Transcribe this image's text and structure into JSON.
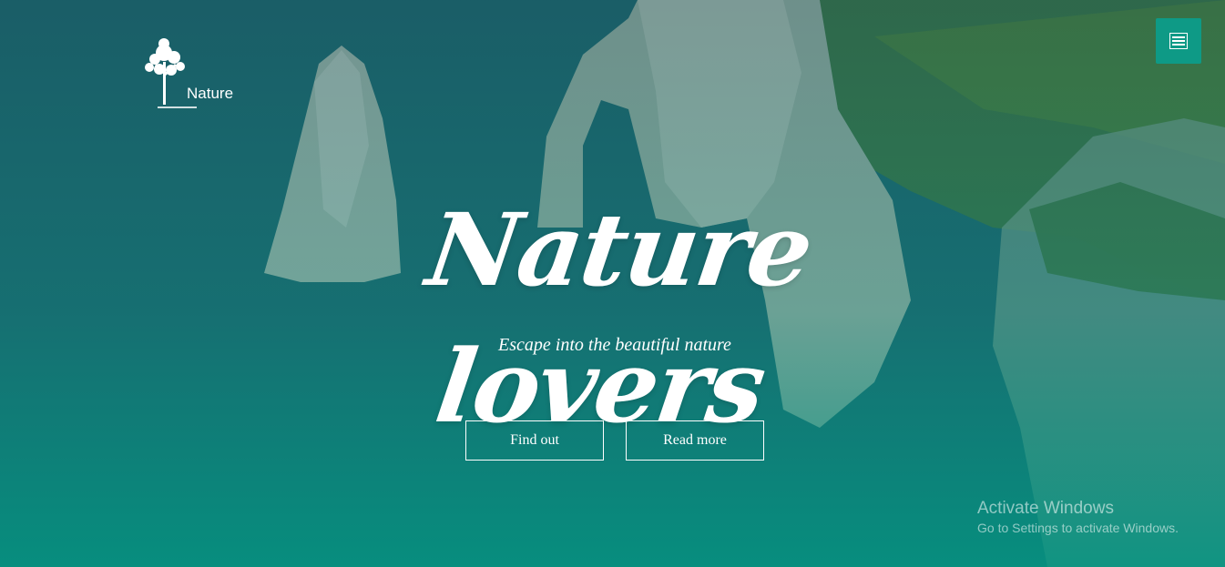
{
  "logo": {
    "text": "Nature",
    "icon": "tree-icon"
  },
  "header": {
    "menu_icon": "hamburger-menu-icon",
    "menu_button_color": "#0e9a86"
  },
  "hero": {
    "headline": "Nature lovers",
    "subtitle": "Escape into the beautiful nature",
    "buttons": [
      {
        "label": "Find out"
      },
      {
        "label": "Read more"
      }
    ],
    "accent_color": "#049181"
  },
  "windows_watermark": {
    "title": "Activate Windows",
    "subtitle": "Go to Settings to activate Windows."
  }
}
